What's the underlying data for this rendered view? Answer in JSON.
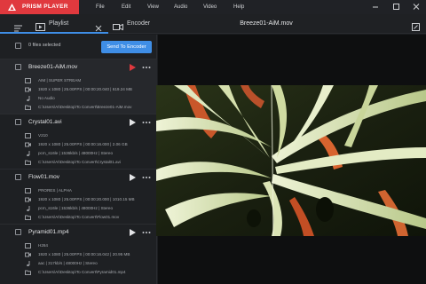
{
  "app": {
    "brand": "PRISM PLAYER",
    "accent": "#e0393e",
    "highlight": "#3f8ee6"
  },
  "menu": {
    "items": [
      "File",
      "Edit",
      "View",
      "Audio",
      "Video",
      "Help"
    ]
  },
  "tabs": {
    "playlist": "Playlist",
    "encoder": "Encoder"
  },
  "current_file": "Breeze01-AiM.mov",
  "playlist": {
    "selected_text": "0 files selected",
    "send_label": "Send To Encoder",
    "items": [
      {
        "name": "Breeze01-AiM.mov",
        "codec": "AIM | SUPER STREAM",
        "video": "1920 x 1080 | 25.00FPS | 00:00:20.040 | 619.24 MB",
        "audio": "No Audio",
        "path": "C:\\Users\\AI\\Desktop\\To Convert\\Breeze01-AiM.mov"
      },
      {
        "name": "Crystal01.avi",
        "codec": "V210",
        "video": "1920 x 1080 | 25.00FPS | 00:00:16.000 | 2.06 GB",
        "audio": "pcm_s16le | 1536kb/s | 48000Hz | Stereo",
        "path": "C:\\Users\\AI\\Desktop\\To Convert\\Crystal01.avi"
      },
      {
        "name": "Flow01.mov",
        "codec": "PRORES | ALPHA",
        "video": "1920 x 1080 | 25.00FPS | 00:00:20.000 | 1010.15 MB",
        "audio": "pcm_s16le | 1536kb/s | 48000Hz | Stereo",
        "path": "C:\\Users\\AI\\Desktop\\To Convert\\Flow01.mov"
      },
      {
        "name": "Pyramid01.mp4",
        "codec": "H264",
        "video": "1920 x 1080 | 25.00FPS | 00:00:16.042 | 20.95 MB",
        "audio": "aac | 317kb/s | 48000Hz | Stereo",
        "path": "C:\\Users\\AI\\Desktop\\To Convert\\Pyramid01.mp4"
      }
    ]
  }
}
